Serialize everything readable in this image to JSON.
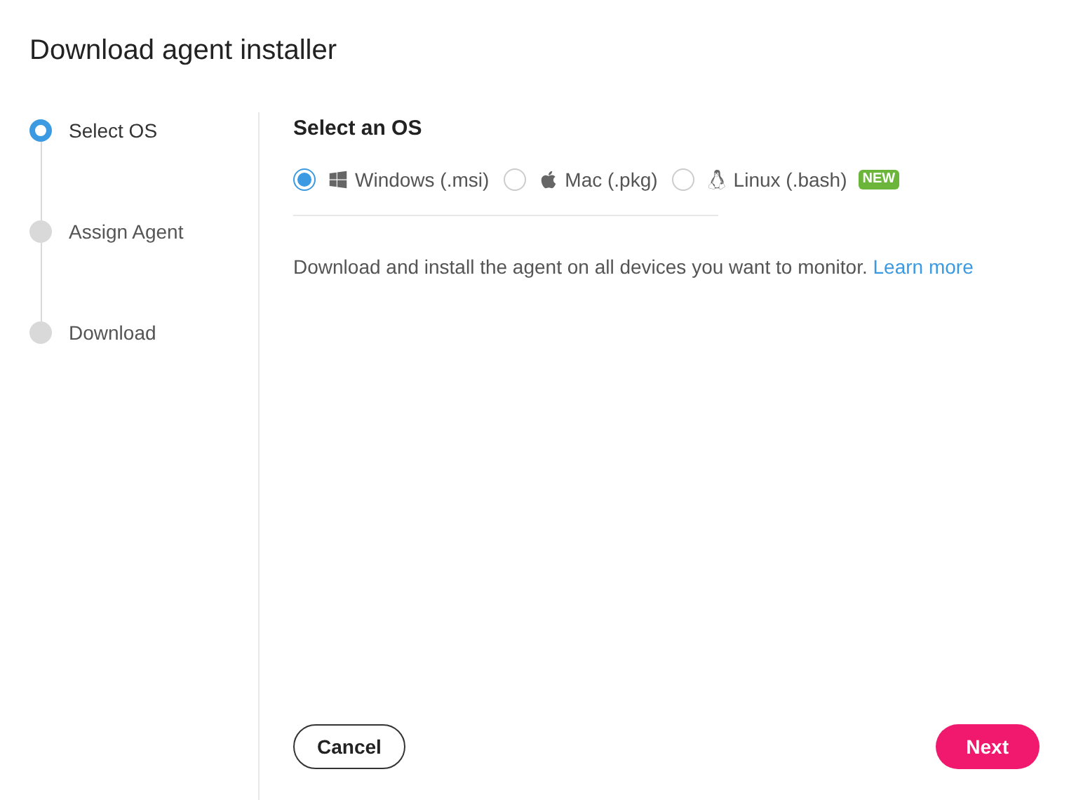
{
  "dialog": {
    "title": "Download agent installer"
  },
  "steps": [
    {
      "label": "Select OS",
      "selected": true
    },
    {
      "label": "Assign Agent",
      "selected": false
    },
    {
      "label": "Download",
      "selected": false
    }
  ],
  "section": {
    "heading": "Select an OS",
    "os_options": [
      {
        "kind": "windows",
        "label": "Windows (.msi)",
        "selected": true
      },
      {
        "kind": "mac",
        "label": "Mac (.pkg)",
        "selected": false
      },
      {
        "kind": "linux",
        "label": "Linux (.bash)",
        "selected": false,
        "badge": "NEW"
      }
    ],
    "description": "Download and install the agent on all devices you want to monitor.",
    "link": "Learn more"
  },
  "buttons": {
    "cancel": "Cancel",
    "next": "Next"
  }
}
